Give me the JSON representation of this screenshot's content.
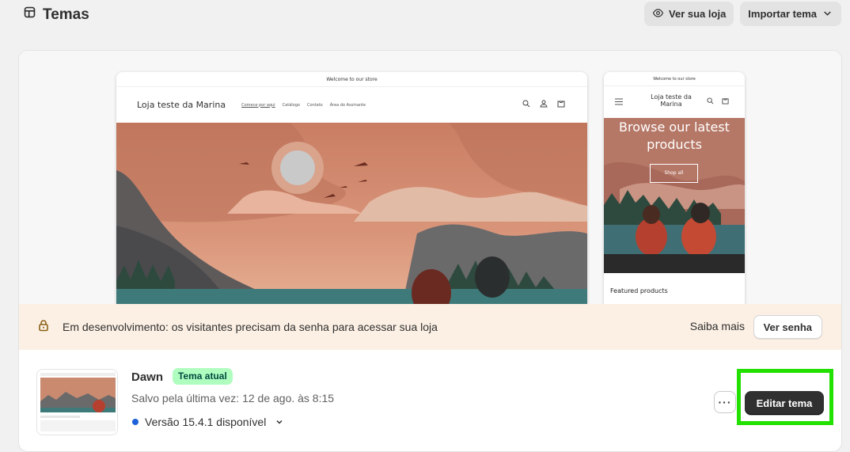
{
  "header": {
    "title": "Temas",
    "view_store_label": "Ver sua loja",
    "import_theme_label": "Importar tema"
  },
  "preview": {
    "announcement": "Welcome to our store",
    "store_name": "Loja teste da Marina",
    "nav_links": [
      "Comece por aqui",
      "Catálogo",
      "Contato",
      "Área do Assinante"
    ],
    "mobile_headline": "Browse our latest products",
    "mobile_button": "Shop all",
    "mobile_section": "Featured products"
  },
  "dev_banner": {
    "message": "Em desenvolvimento: os visitantes precisam da senha para acessar sua loja",
    "learn_more": "Saiba mais",
    "show_password": "Ver senha"
  },
  "theme": {
    "name": "Dawn",
    "badge": "Tema atual",
    "saved": "Salvo pela última vez: 12 de ago. às 8:15",
    "version": "Versão 15.4.1 disponível",
    "more_label": "···",
    "edit_label": "Editar tema"
  },
  "colors": {
    "highlight": "#22e000",
    "badge_bg": "#affebf",
    "version_dot": "#1d62d9",
    "banner_bg": "#fcf0e4"
  }
}
